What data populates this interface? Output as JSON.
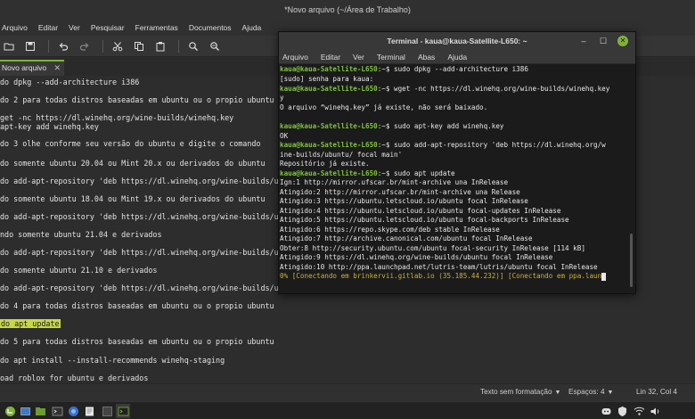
{
  "editor": {
    "window_title": "*Novo arquivo (~/Área de Trabalho)",
    "menu": [
      "Arquivo",
      "Editar",
      "Ver",
      "Pesquisar",
      "Ferramentas",
      "Documentos",
      "Ajuda"
    ],
    "tab_label": "Novo arquivo",
    "lines": [
      "do dpkg --add-architecture i386",
      "do 2 para todas distros baseadas em ubuntu ou o propio ubuntu",
      "get -nc https://dl.winehq.org/wine-builds/winehq.key",
      "apt-key add winehq.key",
      "do 3 olhe conforme seu versão do ubuntu e digite o comando",
      "do somente ubuntu 20.04 ou Mint 20.x ou derivados do ubuntu",
      "do add-apt-repository 'deb https://dl.winehq.org/wine-builds/ubu",
      "do somente ubuntu 18.04 ou Mint 19.x ou derivados do ubuntu",
      "do add-apt-repository 'deb https://dl.winehq.org/wine-builds/ubu",
      "ndo somente ubuntu 21.04 e derivados",
      "do add-apt-repository 'deb https://dl.winehq.org/wine-builds/ubu",
      "do somente ubuntu 21.10 e derivados",
      "do add-apt-repository 'deb https://dl.winehq.org/wine-builds/ubuntu/ impish main'",
      "do 4 para todas distros baseadas em ubuntu ou o propio ubuntu",
      "do apt update",
      "do 5 para todas distros baseadas em ubuntu ou o propio ubuntu",
      "do apt install --install-recommends winehq-staging",
      "oad roblox for ubuntu e derivados"
    ],
    "status": {
      "format": "Texto sem formatação",
      "spaces": "Espaços: 4",
      "position": "Lin 32, Col 4"
    }
  },
  "terminal": {
    "title": "Terminal - kaua@kaua-Satellite-L650: ~",
    "menu": [
      "Arquivo",
      "Editar",
      "Ver",
      "Terminal",
      "Abas",
      "Ajuda"
    ],
    "prompt": "kaua@kaua-Satellite-L650",
    "lines": [
      {
        "p": true,
        "cmd": ":~$ sudo dpkg --add-architecture i386"
      },
      {
        "text": "[sudo] senha para kaua:"
      },
      {
        "p": true,
        "cmd": ":~$ wget -nc https://dl.winehq.org/wine-builds/winehq.key"
      },
      {
        "text": "y"
      },
      {
        "text": "O arquivo “winehq.key” já existe, não será baixado."
      },
      {
        "text": ""
      },
      {
        "p": true,
        "cmd": ":~$ sudo apt-key add winehq.key"
      },
      {
        "text": "OK"
      },
      {
        "p": true,
        "cmd": ":~$ sudo add-apt-repository 'deb https://dl.winehq.org/w"
      },
      {
        "text": "ine-builds/ubuntu/ focal main'"
      },
      {
        "text": "Repositório já existe."
      },
      {
        "p": true,
        "cmd": ":~$ sudo apt update"
      },
      {
        "text": "Ign:1 http://mirror.ufscar.br/mint-archive una InRelease"
      },
      {
        "text": "Atingido:2 http://mirror.ufscar.br/mint-archive una Release"
      },
      {
        "text": "Atingido:3 https://ubuntu.letscloud.io/ubuntu focal InRelease"
      },
      {
        "text": "Atingido:4 https://ubuntu.letscloud.io/ubuntu focal-updates InRelease"
      },
      {
        "text": "Atingido:5 https://ubuntu.letscloud.io/ubuntu focal-backports InRelease"
      },
      {
        "text": "Atingido:6 https://repo.skype.com/deb stable InRelease"
      },
      {
        "text": "Atingido:7 http://archive.canonical.com/ubuntu focal InRelease"
      },
      {
        "text": "Obter:8 http://security.ubuntu.com/ubuntu focal-security InRelease [114 kB]"
      },
      {
        "text": "Atingido:9 https://dl.winehq.org/wine-builds/ubuntu focal InRelease"
      },
      {
        "text": "Atingido:10 http://ppa.launchpad.net/lutris-team/lutris/ubuntu focal InRelease"
      },
      {
        "progress": "0% [Conectando em brinkervii.gitlab.io (35.185.44.232)] [Conectando em ppa.laun"
      }
    ]
  },
  "taskbar": {
    "icons": [
      "menu-icon",
      "show-desktop-icon",
      "files-icon",
      "terminal-icon",
      "browser-icon",
      "editor-icon",
      "app-icon"
    ],
    "tray_icons": [
      "discord-icon",
      "shield-icon",
      "network-icon",
      "volume-icon"
    ]
  },
  "colors": {
    "accent": "#7fb239",
    "highlight": "#c6d74c",
    "link": "#4f8fe6",
    "progress": "#c8b43a"
  }
}
